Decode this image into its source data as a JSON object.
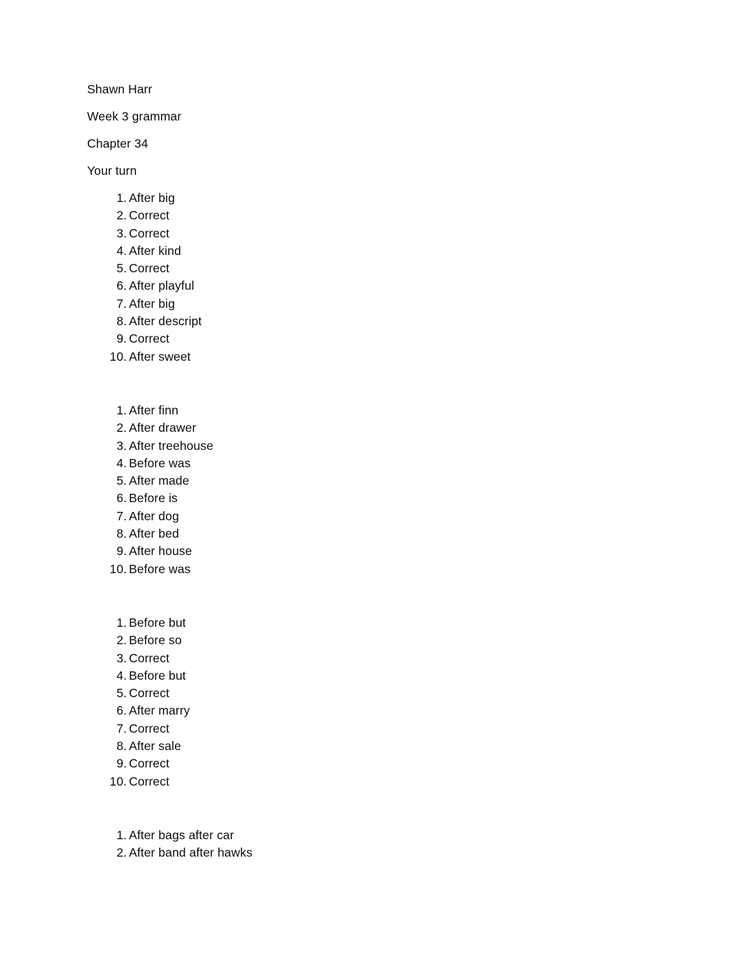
{
  "document": {
    "page_background": "#ffffff",
    "text_color": "#0d0d0d",
    "header_lines": [
      {
        "text": "Shawn Harr"
      },
      {
        "text": "Week 3 grammar"
      },
      {
        "text": "Chapter 34"
      },
      {
        "text": "Your turn"
      }
    ],
    "lists": [
      {
        "id": "list-1",
        "items": [
          {
            "number": "1.",
            "text": "After big"
          },
          {
            "number": "2.",
            "text": "Correct"
          },
          {
            "number": "3.",
            "text": "Correct"
          },
          {
            "number": "4.",
            "text": "After kind"
          },
          {
            "number": "5.",
            "text": "Correct"
          },
          {
            "number": "6.",
            "text": "After playful"
          },
          {
            "number": "7.",
            "text": "After big"
          },
          {
            "number": "8.",
            "text": "After descript"
          },
          {
            "number": "9.",
            "text": "Correct"
          },
          {
            "number": "10.",
            "text": "After sweet"
          }
        ]
      },
      {
        "id": "list-2",
        "items": [
          {
            "number": "1.",
            "text": "After finn"
          },
          {
            "number": "2.",
            "text": "After drawer"
          },
          {
            "number": "3.",
            "text": "After treehouse"
          },
          {
            "number": "4.",
            "text": "Before was"
          },
          {
            "number": "5.",
            "text": "After made"
          },
          {
            "number": "6.",
            "text": "Before is"
          },
          {
            "number": "7.",
            "text": "After dog"
          },
          {
            "number": "8.",
            "text": "After bed"
          },
          {
            "number": "9.",
            "text": "After house"
          },
          {
            "number": "10.",
            "text": "Before was"
          }
        ]
      },
      {
        "id": "list-3",
        "items": [
          {
            "number": "1.",
            "text": "Before but"
          },
          {
            "number": "2.",
            "text": "Before so"
          },
          {
            "number": "3.",
            "text": "Correct"
          },
          {
            "number": "4.",
            "text": "Before but"
          },
          {
            "number": "5.",
            "text": "Correct"
          },
          {
            "number": "6.",
            "text": "After marry"
          },
          {
            "number": "7.",
            "text": "Correct"
          },
          {
            "number": "8.",
            "text": "After sale"
          },
          {
            "number": "9.",
            "text": "Correct"
          },
          {
            "number": "10.",
            "text": "Correct"
          }
        ]
      },
      {
        "id": "list-4",
        "items": [
          {
            "number": "1.",
            "text": "After bags after car"
          },
          {
            "number": "2.",
            "text": "After band after hawks"
          }
        ]
      }
    ]
  }
}
